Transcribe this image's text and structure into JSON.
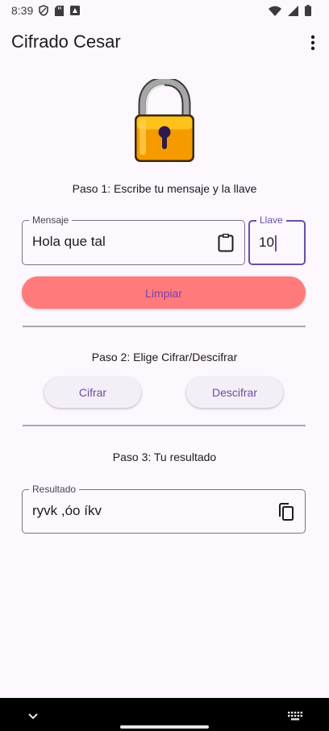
{
  "status_bar": {
    "time": "8:39"
  },
  "app_bar": {
    "title": "Cifrado Cesar"
  },
  "step1": {
    "text": "Paso 1: Escribe tu mensaje y la llave"
  },
  "mensaje": {
    "label": "Mensaje",
    "value": "Hola que tal"
  },
  "llave": {
    "label": "Llave",
    "value": "10"
  },
  "limpiar": {
    "label": "Limpiar"
  },
  "step2": {
    "text": "Paso 2: Elige Cifrar/Descifrar"
  },
  "cifrar": {
    "label": "Cifrar"
  },
  "descifrar": {
    "label": "Descifrar"
  },
  "step3": {
    "text": "Paso 3: Tu resultado"
  },
  "resultado": {
    "label": "Resultado",
    "value": "ryvk ,óo íkv"
  },
  "colors": {
    "accent": "#6750a4",
    "clear_button": "#ff7b7b",
    "background": "#fdf7fe"
  }
}
